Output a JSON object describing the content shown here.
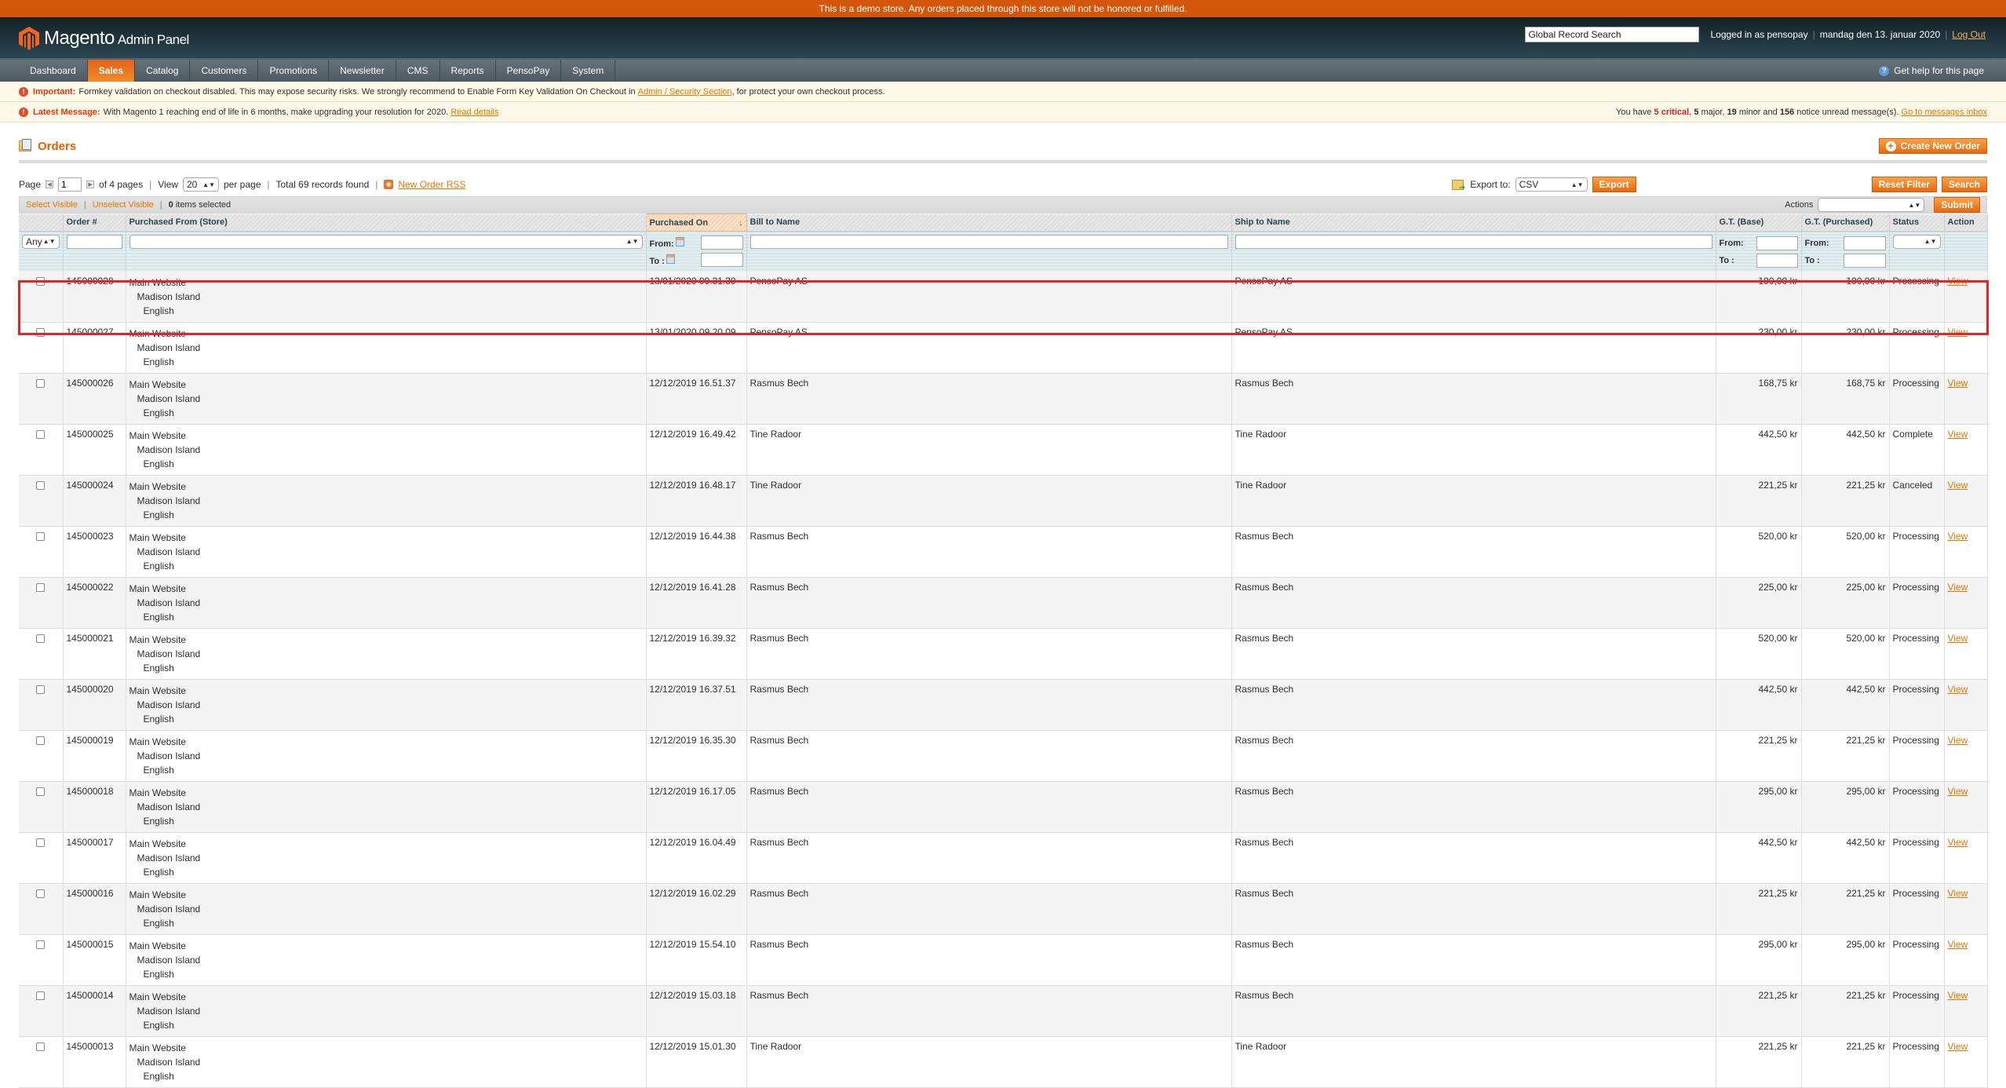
{
  "demo_notice": "This is a demo store. Any orders placed through this store will not be honored or fulfilled.",
  "header": {
    "logo_brand": "Magento",
    "logo_sub": "Admin Panel",
    "global_search_value": "Global Record Search",
    "logged_in": "Logged in as pensopay",
    "date": "mandag den 13. januar 2020",
    "logout": "Log Out"
  },
  "nav": {
    "items": [
      "Dashboard",
      "Sales",
      "Catalog",
      "Customers",
      "Promotions",
      "Newsletter",
      "CMS",
      "Reports",
      "PensoPay",
      "System"
    ],
    "active": "Sales",
    "help": "Get help for this page"
  },
  "messages": {
    "important_label": "Important:",
    "important_text": "Formkey validation on checkout disabled. This may expose security risks. We strongly recommend to Enable Form Key Validation On Checkout in",
    "important_link": "Admin / Security Section",
    "important_tail": ", for protect your own checkout process.",
    "latest_label": "Latest Message:",
    "latest_text": "With Magento 1 reaching end of life in 6 months, make upgrading your resolution for 2020.",
    "latest_link": "Read details",
    "summary_prefix": "You have",
    "critical": "5 critical",
    "major_count": "5",
    "major_label": "major,",
    "minor_count": "19",
    "minor_label": "minor and",
    "notice_count": "156",
    "notice_label": "notice unread message(s).",
    "inbox_link": "Go to messages inbox"
  },
  "page": {
    "title": "Orders",
    "create_button": "Create New Order"
  },
  "pager": {
    "page_label": "Page",
    "page_value": "1",
    "of_pages": "of 4 pages",
    "view_label": "View",
    "per_page_value": "20",
    "per_page_label": "per page",
    "total": "Total 69 records found",
    "rss": "New Order RSS",
    "export_label": "Export to:",
    "export_format": "CSV",
    "export_button": "Export",
    "reset_filter": "Reset Filter",
    "search": "Search"
  },
  "massaction": {
    "select_visible": "Select Visible",
    "unselect_visible": "Unselect Visible",
    "selected_count": "0",
    "selected_label": "items selected",
    "actions_label": "Actions",
    "actions_value": "",
    "submit": "Submit"
  },
  "columns": {
    "order": "Order #",
    "store": "Purchased From (Store)",
    "purchased_on": "Purchased On",
    "bill_to": "Bill to Name",
    "ship_to": "Ship to Name",
    "gt_base": "G.T. (Base)",
    "gt_purchased": "G.T. (Purchased)",
    "status": "Status",
    "action": "Action"
  },
  "filters": {
    "any": "Any",
    "from": "From:",
    "to": "To :"
  },
  "store_lines": [
    "Main Website",
    "Madison Island",
    "English"
  ],
  "rows": [
    {
      "order": "145000028",
      "date": "13/01/2020 09.31.39",
      "bill": "PensoPay AS",
      "ship": "PensoPay AS",
      "base": "190,00 kr",
      "purchased": "190,00 kr",
      "status": "Processing",
      "action": "View"
    },
    {
      "order": "145000027",
      "date": "13/01/2020 09.20.09",
      "bill": "PensoPay AS",
      "ship": "PensoPay AS",
      "base": "230,00 kr",
      "purchased": "230,00 kr",
      "status": "Processing",
      "action": "View"
    },
    {
      "order": "145000026",
      "date": "12/12/2019 16.51.37",
      "bill": "Rasmus Bech",
      "ship": "Rasmus Bech",
      "base": "168,75 kr",
      "purchased": "168,75 kr",
      "status": "Processing",
      "action": "View"
    },
    {
      "order": "145000025",
      "date": "12/12/2019 16.49.42",
      "bill": "Tine Radoor",
      "ship": "Tine Radoor",
      "base": "442,50 kr",
      "purchased": "442,50 kr",
      "status": "Complete",
      "action": "View"
    },
    {
      "order": "145000024",
      "date": "12/12/2019 16.48.17",
      "bill": "Tine Radoor",
      "ship": "Tine Radoor",
      "base": "221,25 kr",
      "purchased": "221,25 kr",
      "status": "Canceled",
      "action": "View"
    },
    {
      "order": "145000023",
      "date": "12/12/2019 16.44.38",
      "bill": "Rasmus Bech",
      "ship": "Rasmus Bech",
      "base": "520,00 kr",
      "purchased": "520,00 kr",
      "status": "Processing",
      "action": "View"
    },
    {
      "order": "145000022",
      "date": "12/12/2019 16.41.28",
      "bill": "Rasmus Bech",
      "ship": "Rasmus Bech",
      "base": "225,00 kr",
      "purchased": "225,00 kr",
      "status": "Processing",
      "action": "View"
    },
    {
      "order": "145000021",
      "date": "12/12/2019 16.39.32",
      "bill": "Rasmus Bech",
      "ship": "Rasmus Bech",
      "base": "520,00 kr",
      "purchased": "520,00 kr",
      "status": "Processing",
      "action": "View"
    },
    {
      "order": "145000020",
      "date": "12/12/2019 16.37.51",
      "bill": "Rasmus Bech",
      "ship": "Rasmus Bech",
      "base": "442,50 kr",
      "purchased": "442,50 kr",
      "status": "Processing",
      "action": "View"
    },
    {
      "order": "145000019",
      "date": "12/12/2019 16.35.30",
      "bill": "Rasmus Bech",
      "ship": "Rasmus Bech",
      "base": "221,25 kr",
      "purchased": "221,25 kr",
      "status": "Processing",
      "action": "View"
    },
    {
      "order": "145000018",
      "date": "12/12/2019 16.17.05",
      "bill": "Rasmus Bech",
      "ship": "Rasmus Bech",
      "base": "295,00 kr",
      "purchased": "295,00 kr",
      "status": "Processing",
      "action": "View"
    },
    {
      "order": "145000017",
      "date": "12/12/2019 16.04.49",
      "bill": "Rasmus Bech",
      "ship": "Rasmus Bech",
      "base": "442,50 kr",
      "purchased": "442,50 kr",
      "status": "Processing",
      "action": "View"
    },
    {
      "order": "145000016",
      "date": "12/12/2019 16.02.29",
      "bill": "Rasmus Bech",
      "ship": "Rasmus Bech",
      "base": "221,25 kr",
      "purchased": "221,25 kr",
      "status": "Processing",
      "action": "View"
    },
    {
      "order": "145000015",
      "date": "12/12/2019 15.54.10",
      "bill": "Rasmus Bech",
      "ship": "Rasmus Bech",
      "base": "295,00 kr",
      "purchased": "295,00 kr",
      "status": "Processing",
      "action": "View"
    },
    {
      "order": "145000014",
      "date": "12/12/2019 15.03.18",
      "bill": "Rasmus Bech",
      "ship": "Rasmus Bech",
      "base": "221,25 kr",
      "purchased": "221,25 kr",
      "status": "Processing",
      "action": "View"
    },
    {
      "order": "145000013",
      "date": "12/12/2019 15.01.30",
      "bill": "Tine Radoor",
      "ship": "Tine Radoor",
      "base": "221,25 kr",
      "purchased": "221,25 kr",
      "status": "Processing",
      "action": "View"
    }
  ],
  "colors": {
    "accent_orange": "#eb5e00",
    "demo_bar": "#d4560b",
    "highlight_border": "#e22626"
  }
}
